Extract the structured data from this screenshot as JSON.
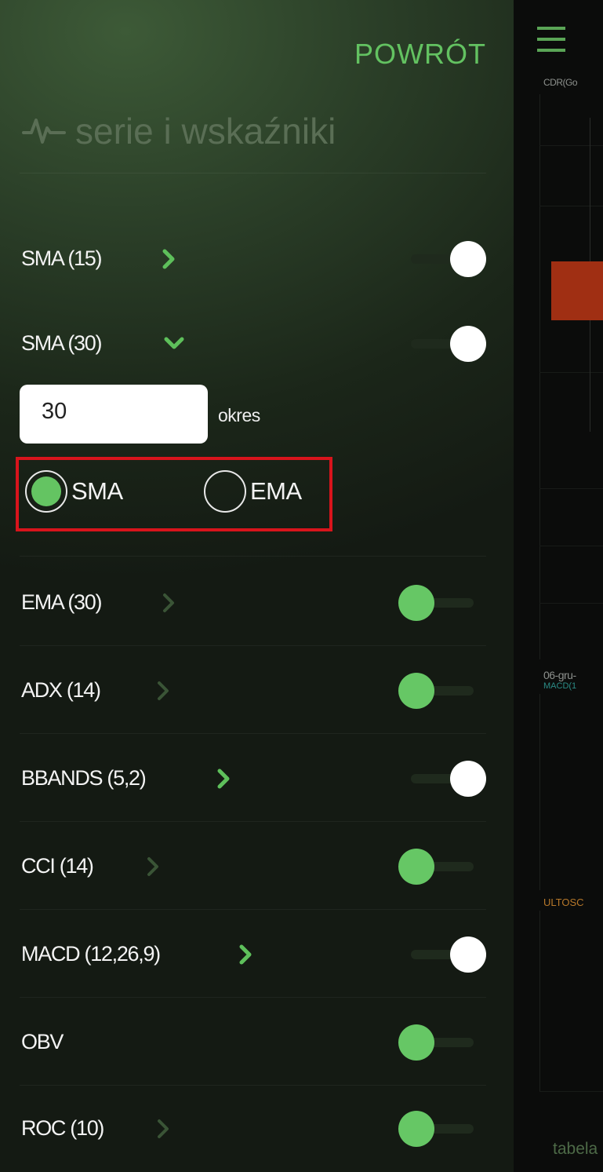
{
  "drawer": {
    "back_label": "POWRÓT",
    "title": "serie i wskaźniki",
    "indicators": [
      {
        "label": "SMA (15)",
        "chevron": "right",
        "chevron_active": true,
        "enabled": true
      },
      {
        "label": "SMA (30)",
        "chevron": "down",
        "chevron_active": true,
        "enabled": true
      },
      {
        "label": "EMA (30)",
        "chevron": "right",
        "chevron_active": false,
        "enabled": false
      },
      {
        "label": "ADX (14)",
        "chevron": "right",
        "chevron_active": false,
        "enabled": false
      },
      {
        "label": "BBANDS (5,2)",
        "chevron": "right",
        "chevron_active": true,
        "enabled": true
      },
      {
        "label": "CCI (14)",
        "chevron": "right",
        "chevron_active": false,
        "enabled": false
      },
      {
        "label": "MACD (12,26,9)",
        "chevron": "right",
        "chevron_active": true,
        "enabled": true
      },
      {
        "label": "OBV",
        "chevron": "none",
        "chevron_active": false,
        "enabled": false
      },
      {
        "label": "ROC (10)",
        "chevron": "right",
        "chevron_active": false,
        "enabled": false
      }
    ],
    "expanded": {
      "period_value": "30",
      "period_label": "okres",
      "ma_types": [
        {
          "label": "SMA",
          "selected": true
        },
        {
          "label": "EMA",
          "selected": false
        }
      ]
    }
  },
  "chart": {
    "symbol": "CDR(Go",
    "date_label": "06-gru-",
    "macd_label": "MACD(1",
    "ulto_label": "ULTOSC",
    "tabela_label": "tabela"
  },
  "colors": {
    "accent": "#63c261",
    "toggle_off_knob": "#66c765",
    "toggle_on_knob": "#ffffff",
    "highlight_box": "#d8141c",
    "candle_down": "#a02f13"
  },
  "icons": {
    "title_icon": "pulse-icon",
    "menu_icon": "hamburger-icon",
    "chevron_right": "chevron-right-icon",
    "chevron_down": "chevron-down-icon"
  }
}
